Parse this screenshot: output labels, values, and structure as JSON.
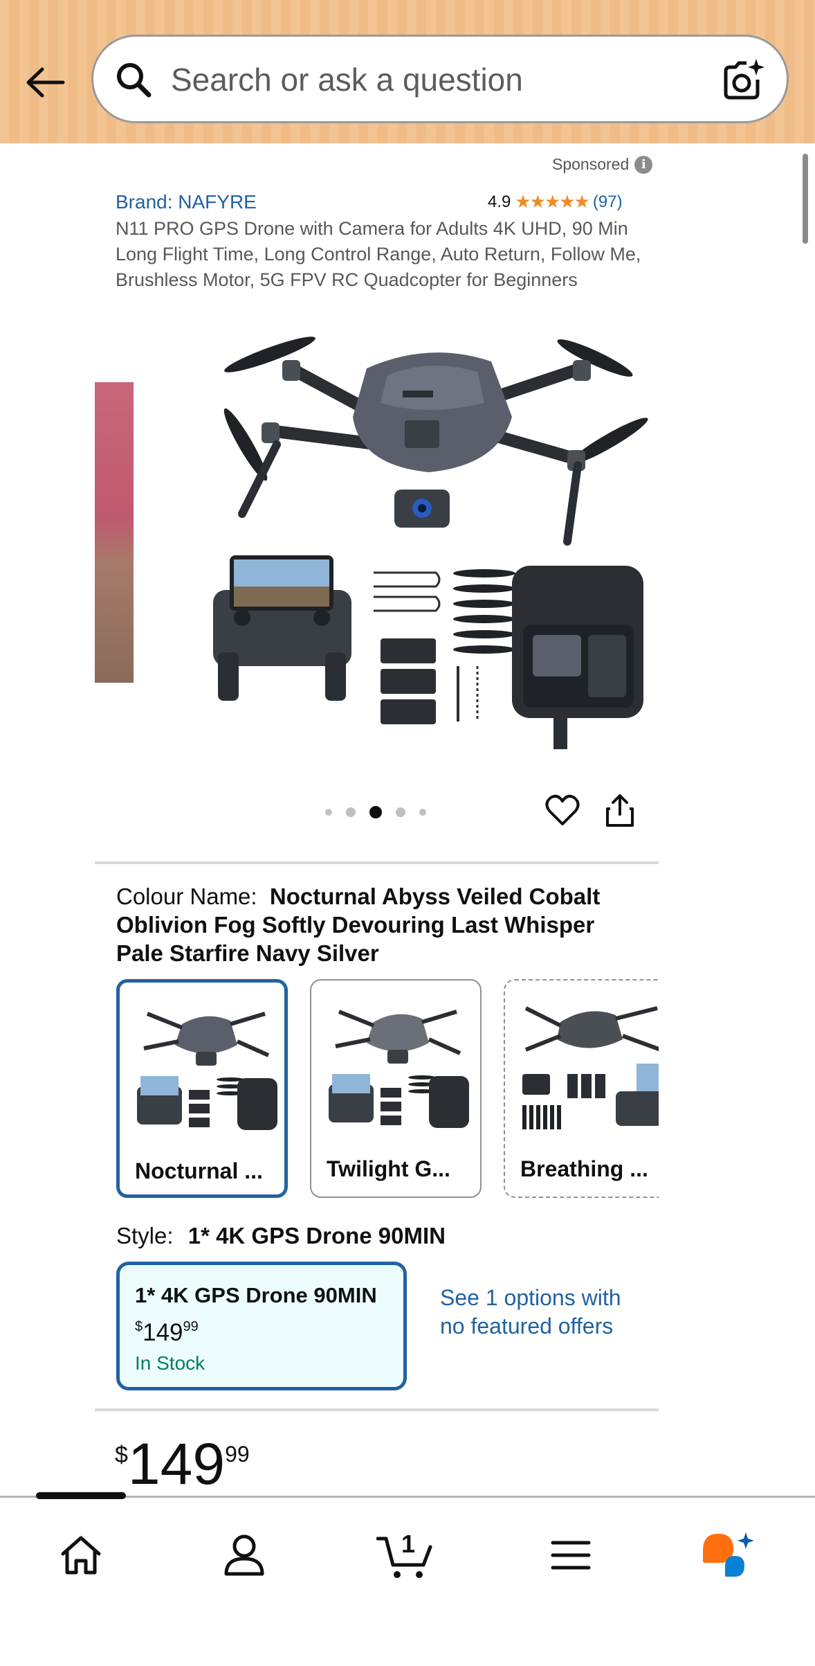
{
  "header": {
    "search_placeholder": "Search or ask a question"
  },
  "ad": {
    "sponsored_label": "Sponsored",
    "info_glyph": "i",
    "brand": "Brand: NAFYRE",
    "rating_value": "4.9",
    "stars": "★★★★★",
    "rating_count": "(97)",
    "title": "N11 PRO GPS Drone with Camera for Adults 4K UHD, 90 Min Long Flight Time, Long Control Range, Auto Return, Follow Me, Brushless Motor, 5G FPV RC Quadcopter for Beginners"
  },
  "carousel": {
    "dot_count": 5,
    "active_index": 2
  },
  "colour": {
    "label": "Colour Name:",
    "value": "Nocturnal Abyss Veiled Cobalt Oblivion Fog Softly Devouring Last Whisper Pale Starfire Navy Silver",
    "swatches": [
      {
        "label": "Nocturnal ..."
      },
      {
        "label": "Twilight G..."
      },
      {
        "label": "Breathing ..."
      }
    ]
  },
  "style": {
    "label": "Style:",
    "value": "1* 4K GPS Drone 90MIN",
    "card": {
      "title": "1* 4K GPS Drone 90MIN",
      "price_currency": "$",
      "price_whole": "149",
      "price_fraction": "99",
      "stock": "In Stock"
    },
    "see_options": "See 1 options with no featured offers"
  },
  "price": {
    "currency": "$",
    "whole": "149",
    "fraction": "99"
  },
  "bottom_nav": {
    "cart_count": "1",
    "items": [
      "home-icon",
      "account-icon",
      "cart-icon",
      "menu-icon",
      "rufus-assistant-icon"
    ]
  },
  "colors": {
    "header_bg": "#f3c391",
    "link": "#2162a1",
    "star": "#f08a24",
    "in_stock": "#067d62",
    "selected_border": "#2162a1",
    "assistant_orange": "#ff6f0f",
    "assistant_blue": "#0a7fd6"
  }
}
